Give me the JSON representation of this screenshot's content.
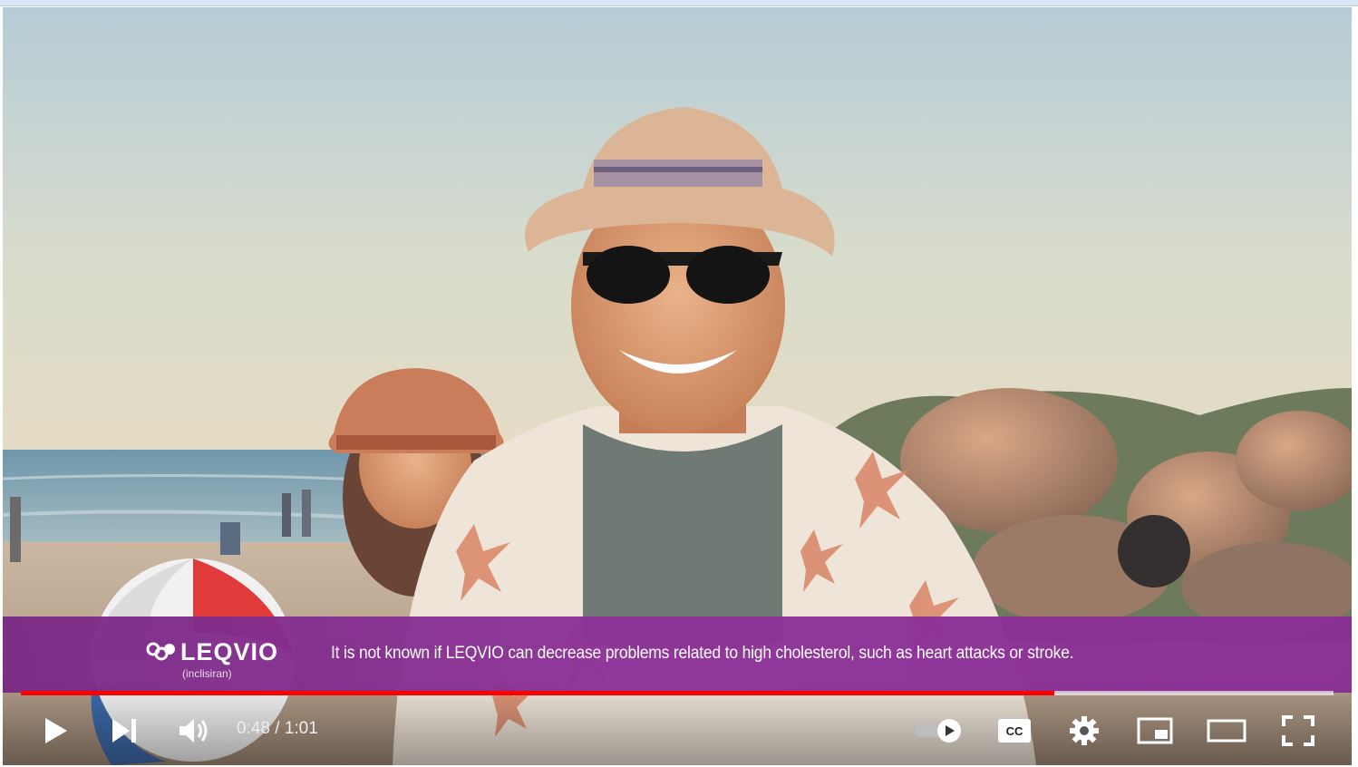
{
  "video": {
    "ad_banner": {
      "brand": "LEQVIO",
      "brand_sub": "(inclisiran)",
      "disclaimer": "It is not known if LEQVIO can decrease problems related to high cholesterol, such as heart attacks or stroke."
    },
    "progress": {
      "played_fraction": 0.787
    },
    "time": {
      "current": "0:48",
      "separator": " / ",
      "duration": "1:01"
    },
    "controls": {
      "play": "play-icon",
      "next": "next-icon",
      "volume": "volume-icon",
      "autoplay": "autoplay-toggle-icon",
      "captions": "cc-icon",
      "settings": "gear-icon",
      "miniplayer": "miniplayer-icon",
      "theater": "theater-icon",
      "fullscreen": "fullscreen-icon"
    },
    "colors": {
      "progress": "#ff0000",
      "banner": "#8a2e95"
    }
  }
}
